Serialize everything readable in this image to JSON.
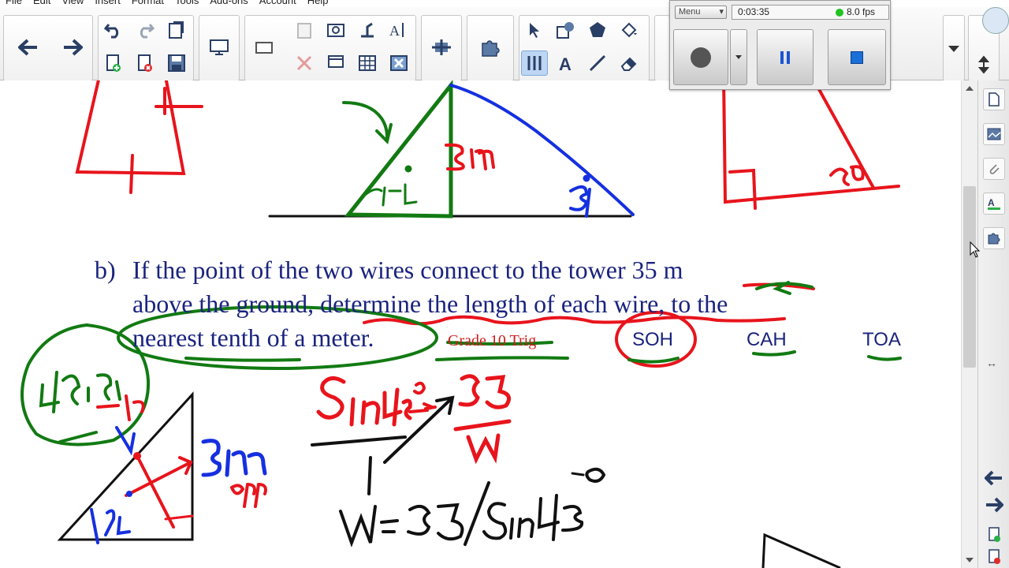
{
  "menu": [
    "File",
    "Edit",
    "View",
    "Insert",
    "Format",
    "Tools",
    "Add-ons",
    "Account",
    "Help"
  ],
  "recorder": {
    "menu_label": "Menu",
    "time": "0:03:35",
    "fps": "8.0 fps"
  },
  "content": {
    "part_label": "b)",
    "line1": "If the point of the two wires connect to the tower 35 m",
    "line2": "above the ground, determine the length of each wire, to the",
    "line3": "nearest tenth of a meter.",
    "grade_label": "Grade 10 Trig",
    "soh": "SOH",
    "cah": "CAH",
    "toa": "TOA"
  },
  "colors": {
    "text_navy": "#1a237e",
    "ink_red": "#e8141c",
    "ink_green": "#127a12",
    "ink_blue": "#1530e0",
    "ink_black": "#111111",
    "grade_label_red": "#cc1d1d",
    "fps_indicator": "#22c322"
  },
  "icons": [
    "back-arrow-icon",
    "forward-arrow-icon",
    "undo-icon",
    "redo-icon",
    "paste-icon",
    "new-page-icon",
    "delete-page-icon",
    "save-icon",
    "screen-shade-icon",
    "camera-icon",
    "delete-icon",
    "clipboard-icon",
    "table-icon",
    "select-icon",
    "shapes-icon",
    "fill-icon",
    "pen-icon",
    "text-icon",
    "line-icon",
    "eraser-icon",
    "addon-icon",
    "scroll-up-icon"
  ]
}
